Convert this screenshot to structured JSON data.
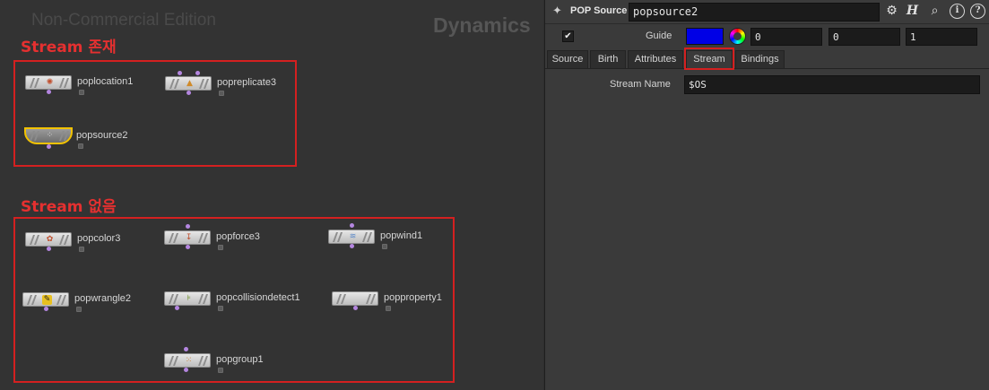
{
  "network": {
    "watermark": "Non-Commercial Edition",
    "context": "Dynamics",
    "annotations": {
      "stream_exists": "Stream 존재",
      "stream_none": "Stream 없음"
    },
    "nodes": {
      "poplocation1": "poplocation1",
      "popreplicate3": "popreplicate3",
      "popsource2": "popsource2",
      "popcolor3": "popcolor3",
      "popforce3": "popforce3",
      "popwind1": "popwind1",
      "popwrangle2": "popwrangle2",
      "popcollisiondetect1": "popcollisiondetect1",
      "popproperty1": "popproperty1",
      "popgroup1": "popgroup1"
    },
    "selected_node": "popsource2",
    "accent_color": "#f2c200",
    "annotation_color": "#d42020"
  },
  "panel": {
    "node_type": "POP Source",
    "node_name": "popsource2",
    "guide": {
      "label": "Guide",
      "checked": true,
      "color": "#0000e6",
      "values": [
        "0",
        "0",
        "1"
      ]
    },
    "tabs": [
      "Source",
      "Birth",
      "Attributes",
      "Stream",
      "Bindings"
    ],
    "active_tab": "Stream",
    "stream": {
      "label": "Stream Name",
      "value": "$OS"
    },
    "toolbar_icons": [
      "gear-icon",
      "houdini-help-icon",
      "search-icon",
      "info-icon",
      "help-icon"
    ]
  }
}
